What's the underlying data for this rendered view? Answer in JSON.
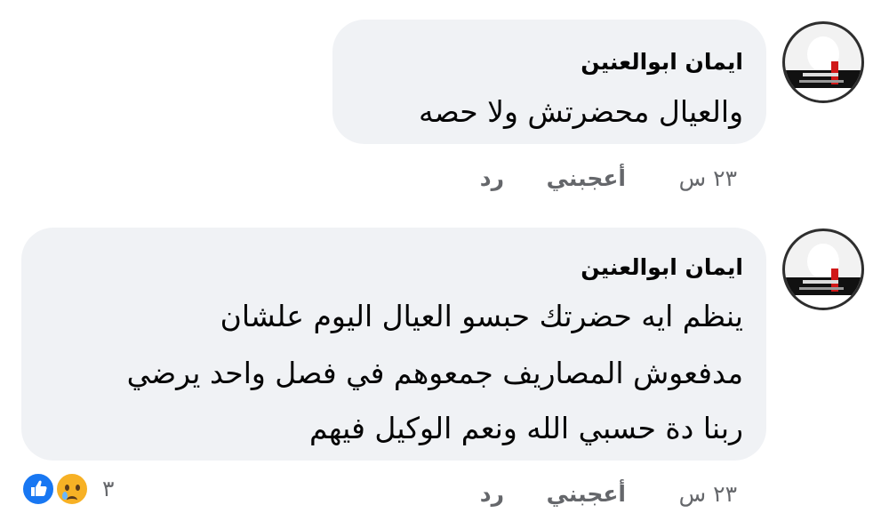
{
  "comments": [
    {
      "author": "ايمان ابوالعنين",
      "lines": [
        "والعيال محضرتش ولا حصه"
      ],
      "time": "٢٣ س",
      "like_label": "أعجبني",
      "reply_label": "رد"
    },
    {
      "author": "ايمان ابوالعنين",
      "lines": [
        "ينظم ايه حضرتك حبسو العيال اليوم علشان",
        "مدفعوش المصاريف جمعوهم في فصل واحد يرضي",
        "ربنا دة حسبي الله ونعم الوكيل فيهم"
      ],
      "time": "٢٣ س",
      "like_label": "أعجبني",
      "reply_label": "رد",
      "reactions": {
        "count": "٣",
        "types": [
          "like-icon",
          "sad-icon"
        ],
        "colors": {
          "like": "#1877f2",
          "sad": "#f7b125"
        }
      }
    }
  ]
}
